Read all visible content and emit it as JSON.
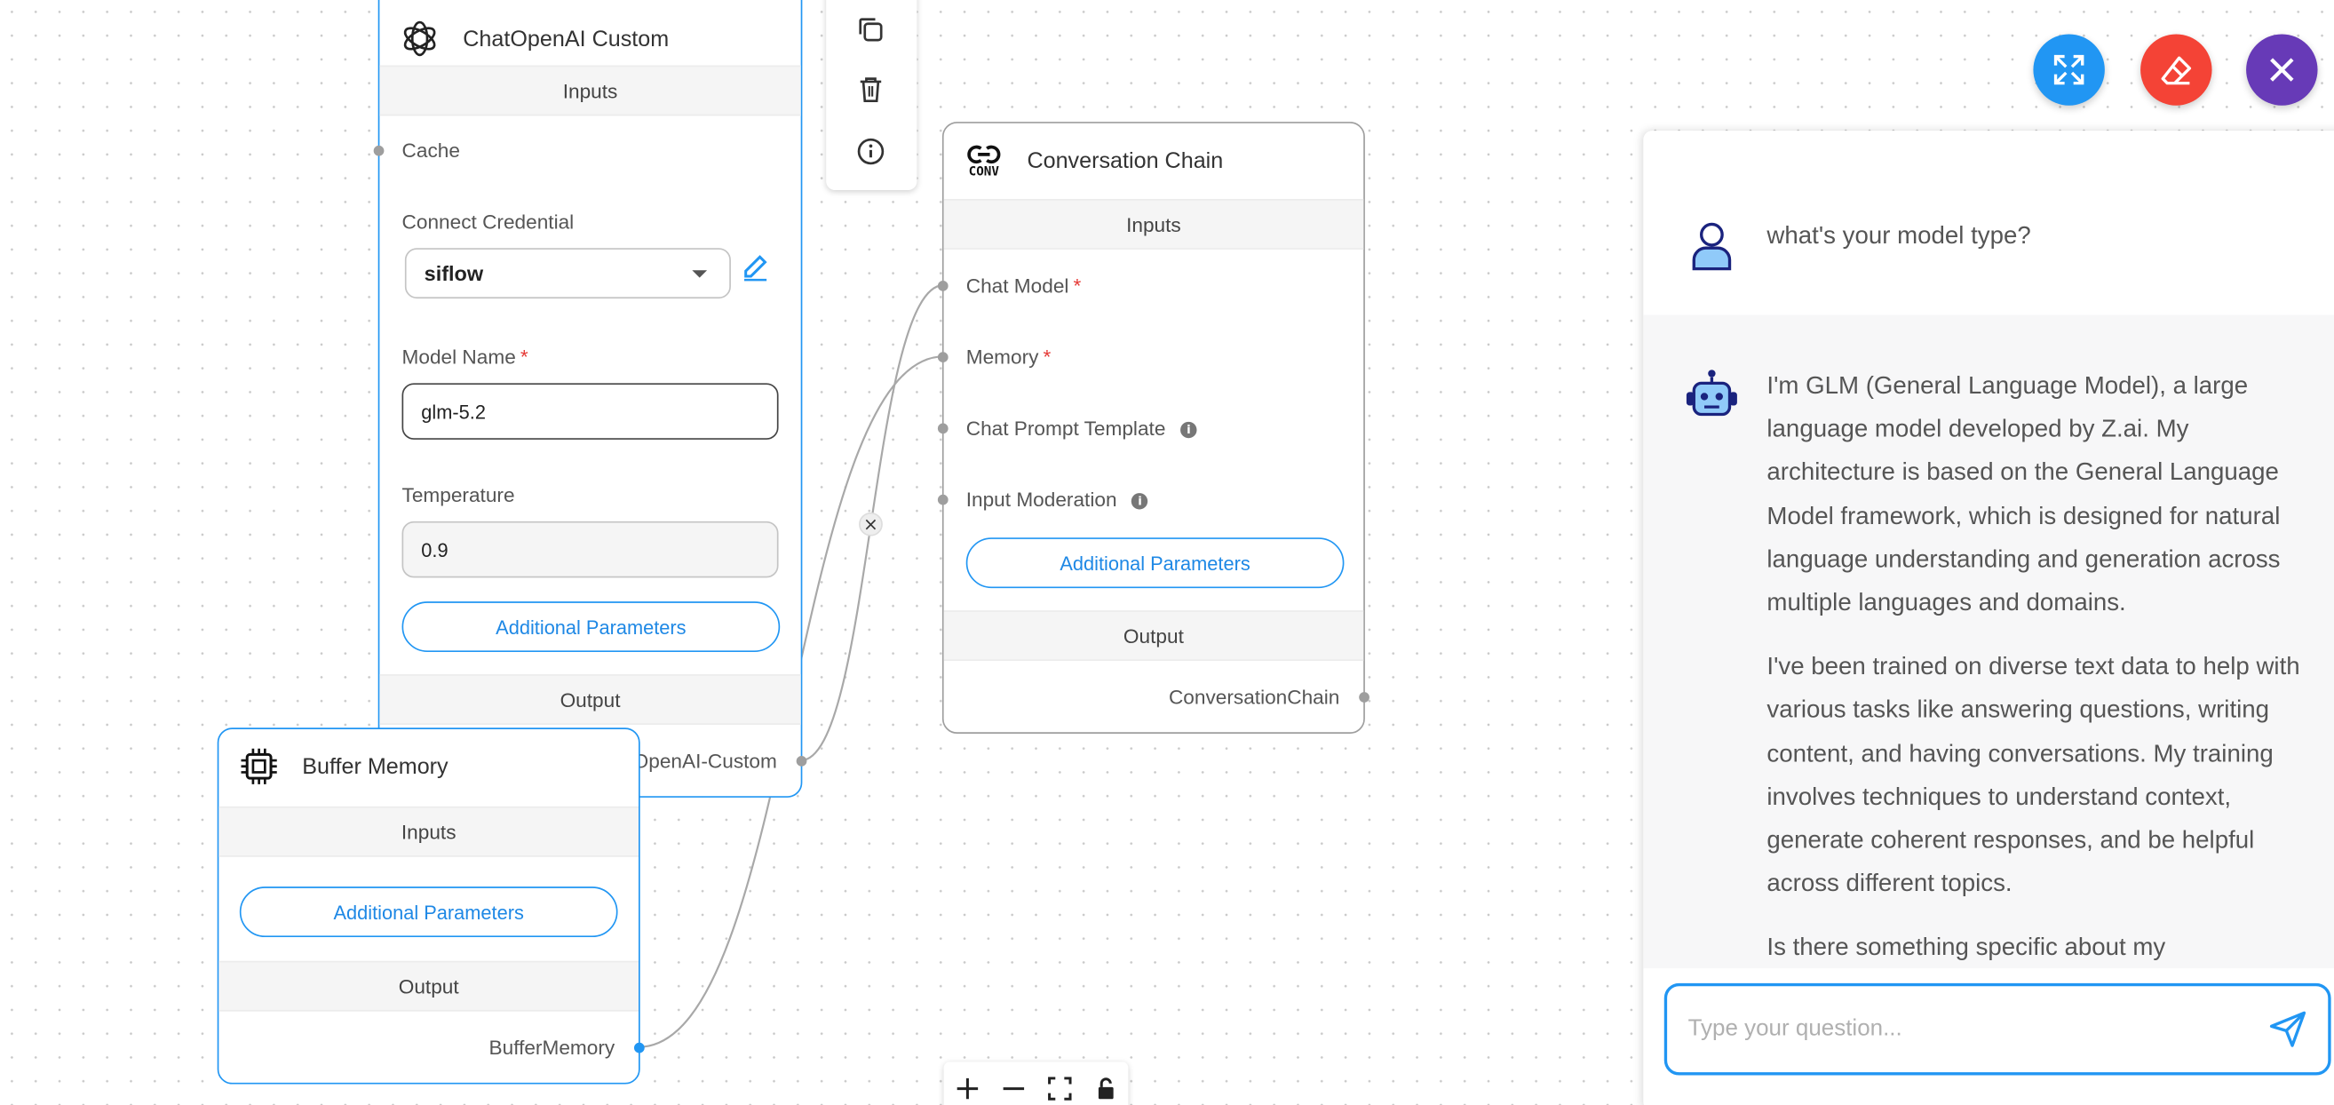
{
  "chatopenai_node": {
    "title": "ChatOpenAI Custom",
    "inputs_label": "Inputs",
    "cache_label": "Cache",
    "credential_label": "Connect Credential",
    "credential_value": "siflow",
    "model_name_label": "Model Name",
    "model_name_value": "glm-5.2",
    "temperature_label": "Temperature",
    "temperature_value": "0.9",
    "additional_params": "Additional Parameters",
    "output_label": "Output",
    "output_value": "ChatOpenAI-Custom",
    "required_mark": "*"
  },
  "conversation_node": {
    "title": "Conversation Chain",
    "icon_text": "CONV",
    "inputs_label": "Inputs",
    "chat_model_label": "Chat Model",
    "memory_label": "Memory",
    "prompt_template_label": "Chat Prompt Template",
    "input_moderation_label": "Input Moderation",
    "additional_params": "Additional Parameters",
    "output_label": "Output",
    "output_value": "ConversationChain",
    "required_mark": "*"
  },
  "buffer_node": {
    "title": "Buffer Memory",
    "inputs_label": "Inputs",
    "additional_params": "Additional Parameters",
    "output_label": "Output",
    "output_value": "BufferMemory"
  },
  "edge_delete_glyph": "×",
  "info_glyph": "i",
  "chat": {
    "user_message": "what's your model type?",
    "bot_paragraphs": [
      "I'm GLM (General Language Model), a large language model developed by Z.ai. My architecture is based on the General Language Model framework, which is designed for natural language understanding and generation across multiple languages and domains.",
      "I've been trained on diverse text data to help with various tasks like answering questions, writing content, and having conversations. My training involves techniques to understand context, generate coherent responses, and be helpful across different topics.",
      "Is there something specific about my"
    ],
    "input_placeholder": "Type your question..."
  },
  "colors": {
    "accent": "#2196f3",
    "fab_expand": "#2196f3",
    "fab_clear": "#f44336",
    "fab_close": "#673ab7",
    "required": "#e53935"
  }
}
